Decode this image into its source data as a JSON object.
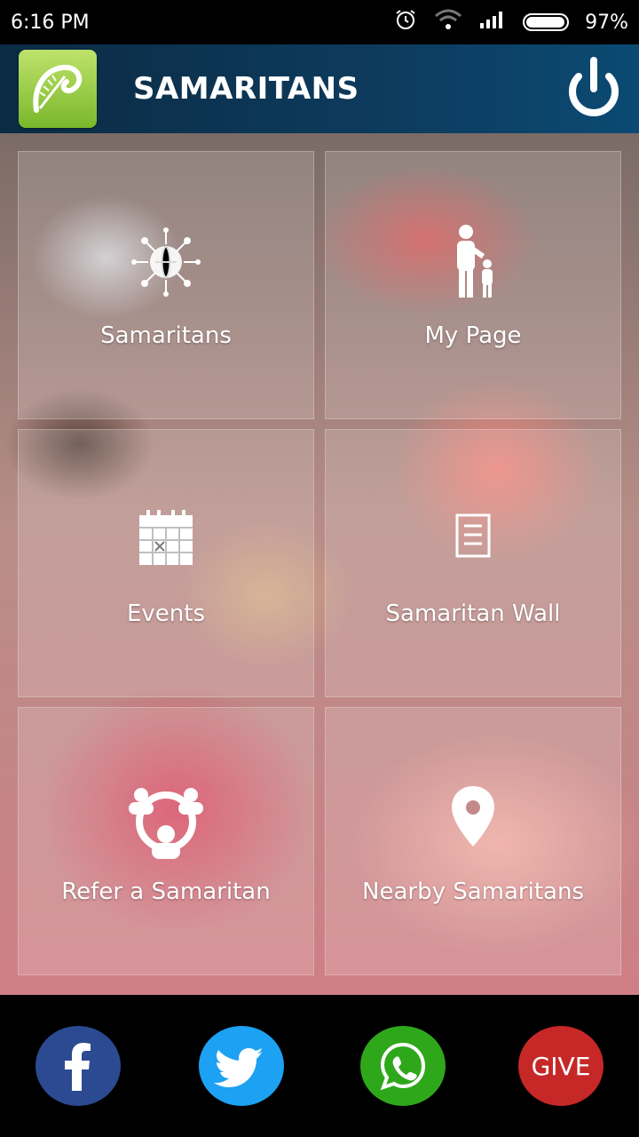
{
  "status": {
    "time": "6:16 PM",
    "battery": "97%"
  },
  "appbar": {
    "title": "SAMARITANS"
  },
  "tiles": [
    {
      "label": "Samaritans",
      "icon": "globe-network-icon"
    },
    {
      "label": "My Page",
      "icon": "parent-child-icon"
    },
    {
      "label": "Events",
      "icon": "calendar-icon"
    },
    {
      "label": "Samaritan Wall",
      "icon": "document-icon"
    },
    {
      "label": "Refer a Samaritan",
      "icon": "people-network-icon"
    },
    {
      "label": "Nearby Samaritans",
      "icon": "location-pin-icon"
    }
  ],
  "bottom": {
    "give_label": "GIVE"
  },
  "colors": {
    "appbar": "#0d3b5d",
    "facebook": "#2b4a91",
    "twitter": "#1da1f2",
    "whatsapp": "#2fa71b",
    "give": "#c62828"
  }
}
